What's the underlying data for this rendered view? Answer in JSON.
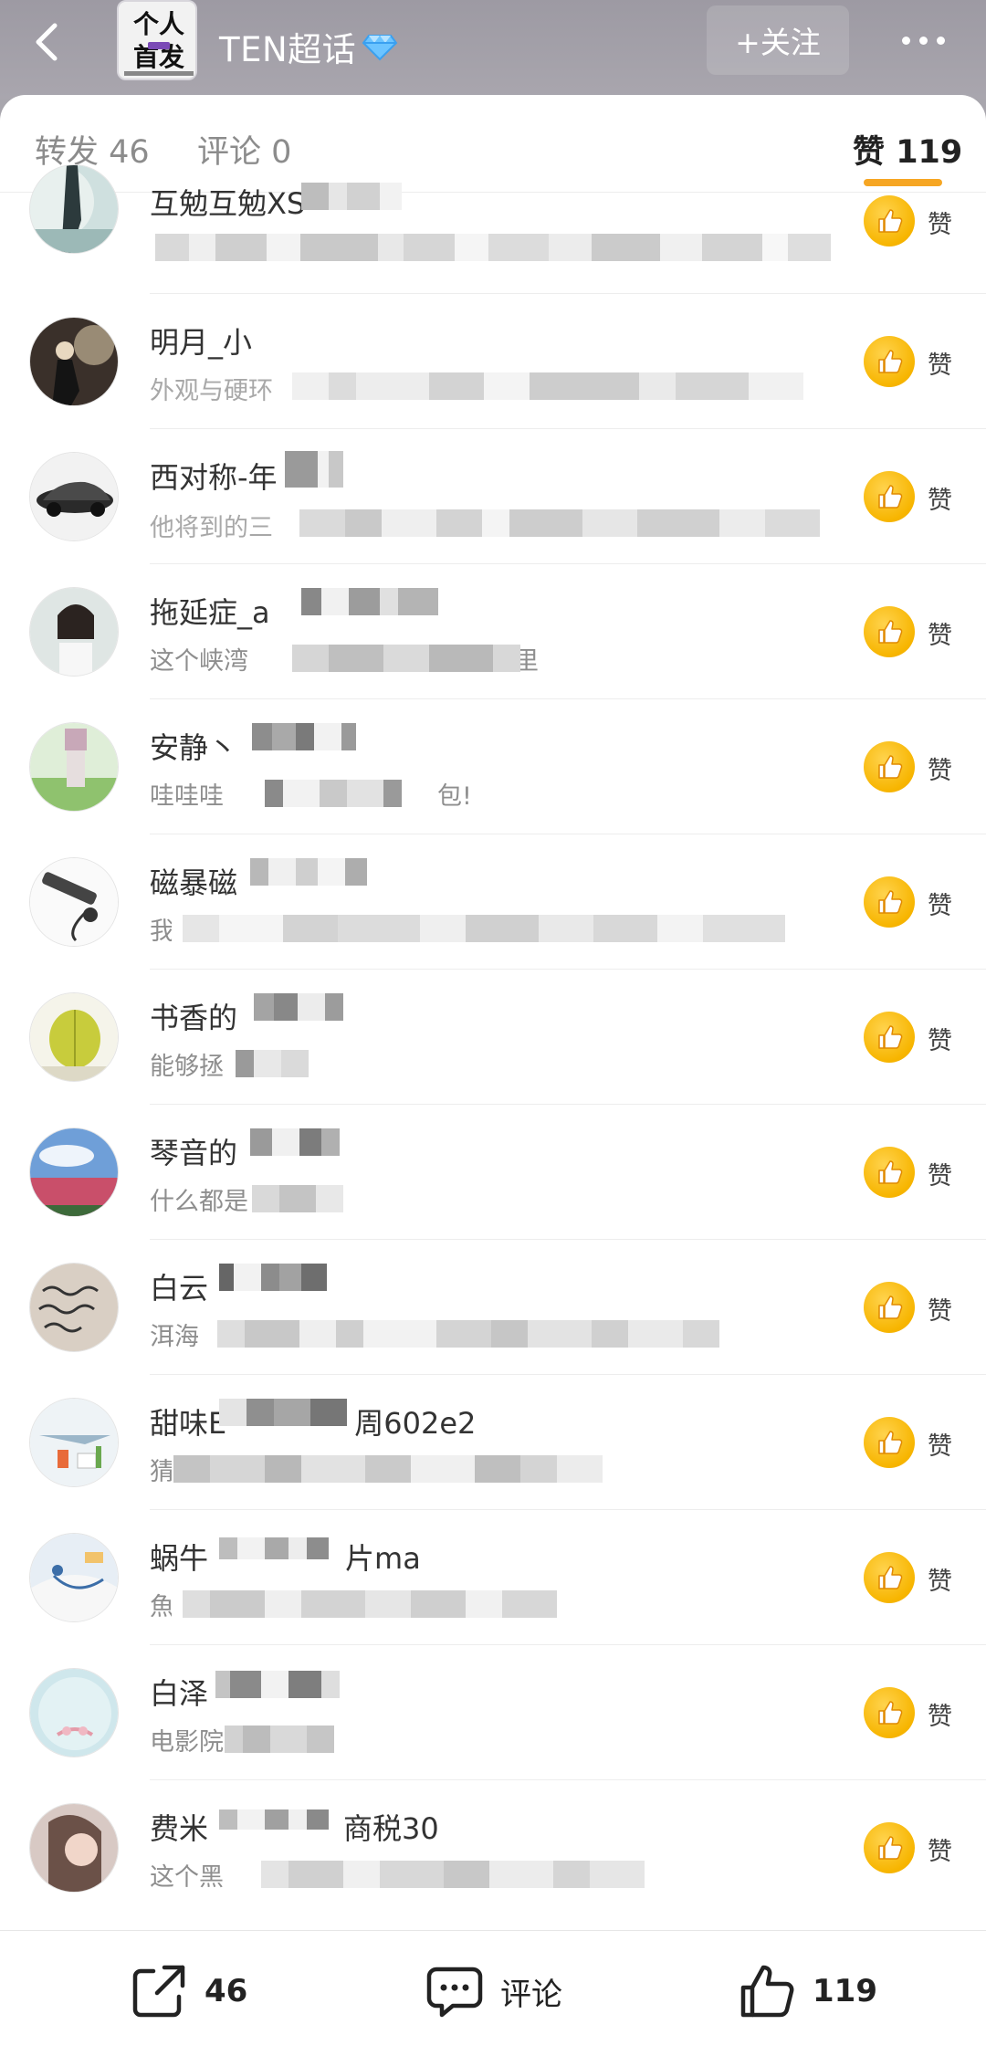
{
  "header": {
    "group_name": "TEN超话",
    "follow_label": "+关注",
    "avatar_top_text": "个人",
    "avatar_bottom_text": "首发"
  },
  "tabs": {
    "reposts": "转发 46",
    "comments": "评论 0",
    "likes_label": "赞",
    "likes_count": "119"
  },
  "like_list": [
    {
      "name": "互勉互勉XS",
      "subtitle": ""
    },
    {
      "name": "明月_小",
      "subtitle": "外观与硬环"
    },
    {
      "name": "西对称-年",
      "subtitle": "他将到的三"
    },
    {
      "name": "拖延症_a",
      "subtitle": "这个峡湾",
      "subtitle_tail": "公里"
    },
    {
      "name": "安静丶",
      "subtitle": "哇哇哇",
      "subtitle_tail": "包!"
    },
    {
      "name": "磁暴磁",
      "subtitle": "我"
    },
    {
      "name": "书香的",
      "subtitle": "能够拯"
    },
    {
      "name": "琴音的",
      "subtitle": "什么都是"
    },
    {
      "name": "白云",
      "subtitle": "洱海"
    },
    {
      "name": "甜味E",
      "name_tail": "周602e2",
      "subtitle": "猜"
    },
    {
      "name": "蜗牛",
      "name_tail": "片ma",
      "subtitle": "魚"
    },
    {
      "name": "白泽",
      "subtitle": "电影院"
    },
    {
      "name": "费米",
      "name_tail": "商税30",
      "subtitle": "这个黑"
    }
  ],
  "like_action_label": "赞",
  "bottom_bar": {
    "repost_count": "46",
    "comment_label": "评论",
    "like_count": "119"
  },
  "colors": {
    "accent": "#f6a623",
    "like_badge": "#f7b500",
    "header_bg": "#a8a6ad"
  }
}
